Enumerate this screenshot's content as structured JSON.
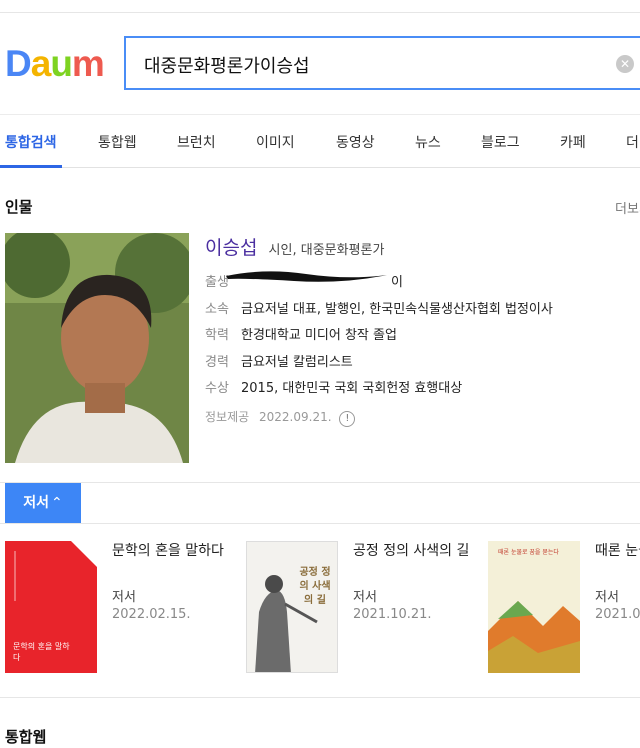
{
  "logo": {
    "text": "Daum",
    "letters": [
      "D",
      "a",
      "u",
      "m"
    ]
  },
  "search": {
    "query": "대중문화평론가이승섭",
    "clear_icon": "clear-icon"
  },
  "tabs": [
    {
      "label": "통합검색",
      "active": true
    },
    {
      "label": "통합웹"
    },
    {
      "label": "브런치"
    },
    {
      "label": "이미지"
    },
    {
      "label": "동영상"
    },
    {
      "label": "뉴스"
    },
    {
      "label": "블로그"
    },
    {
      "label": "카페"
    },
    {
      "label": "더"
    }
  ],
  "person_section": {
    "title": "인물",
    "more": "더보기",
    "name": "이승섭",
    "role": "시인, 대중문화평론가",
    "rows": [
      {
        "label": "출생",
        "value": "이"
      },
      {
        "label": "소속",
        "value": "금요저널 대표, 발행인, 한국민속식물생산자협회 법정이사"
      },
      {
        "label": "학력",
        "value": "한경대학교 미디어 창작 졸업"
      },
      {
        "label": "경력",
        "value": "금요저널 칼럼리스트"
      },
      {
        "label": "수상",
        "value": "2015, 대한민국 국회 국회헌정 효행대상"
      }
    ],
    "provider_label": "정보제공",
    "provider_date": "2022.09.21."
  },
  "works": {
    "tab_label": "저서",
    "books": [
      {
        "title": "문학의 혼을 말하다",
        "type": "저서",
        "date": "2022.02.15.",
        "cover_text": "문학의 혼을 말하다"
      },
      {
        "title": "공정 정의 사색의 길",
        "type": "저서",
        "date": "2021.10.21.",
        "cover_text": "공정 정의 사색의 길"
      },
      {
        "title": "때론 눈물을 묻는다",
        "type": "저서",
        "date": "2021.0",
        "cover_text": "때론 눈물로 꿈을 묻는다"
      }
    ]
  },
  "web_section": {
    "title": "통합웹"
  }
}
